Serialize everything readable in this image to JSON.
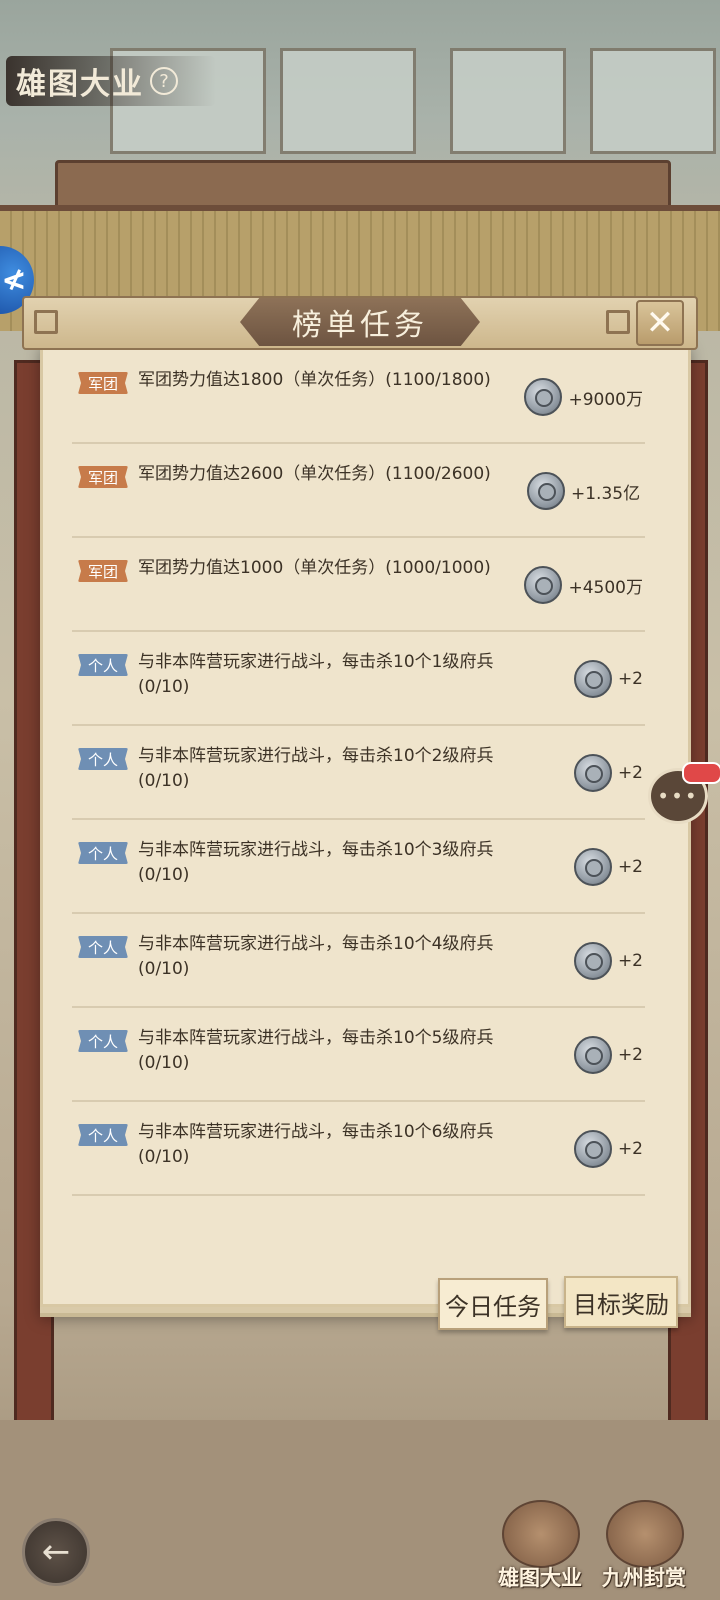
{
  "title": {
    "text": "雄图大业",
    "help": "?"
  },
  "panel": {
    "title": "榜单任务",
    "close": "✕"
  },
  "tasks": [
    {
      "badge": "军团",
      "type": "army",
      "text": "军团势力值达1800（单次任务）(1100/1800)",
      "reward": "+9000万"
    },
    {
      "badge": "军团",
      "type": "army",
      "text": "军团势力值达2600（单次任务）(1100/2600)",
      "reward": "+1.35亿"
    },
    {
      "badge": "军团",
      "type": "army",
      "text": "军团势力值达1000（单次任务）(1000/1000)",
      "reward": "+4500万"
    },
    {
      "badge": "个人",
      "type": "personal",
      "text": "与非本阵营玩家进行战斗，每击杀10个1级府兵(0/10)",
      "reward": "+2"
    },
    {
      "badge": "个人",
      "type": "personal",
      "text": "与非本阵营玩家进行战斗，每击杀10个2级府兵(0/10)",
      "reward": "+2"
    },
    {
      "badge": "个人",
      "type": "personal",
      "text": "与非本阵营玩家进行战斗，每击杀10个3级府兵(0/10)",
      "reward": "+2"
    },
    {
      "badge": "个人",
      "type": "personal",
      "text": "与非本阵营玩家进行战斗，每击杀10个4级府兵(0/10)",
      "reward": "+2"
    },
    {
      "badge": "个人",
      "type": "personal",
      "text": "与非本阵营玩家进行战斗，每击杀10个5级府兵(0/10)",
      "reward": "+2"
    },
    {
      "badge": "个人",
      "type": "personal",
      "text": "与非本阵营玩家进行战斗，每击杀10个6级府兵(0/10)",
      "reward": "+2"
    }
  ],
  "tabs": {
    "today": "今日任务",
    "goal": "目标奖励"
  },
  "bottom_nav": {
    "back": "←",
    "btn1": "雄图大业",
    "btn2": "九州封赏"
  },
  "chat": {
    "dots": "•••"
  }
}
